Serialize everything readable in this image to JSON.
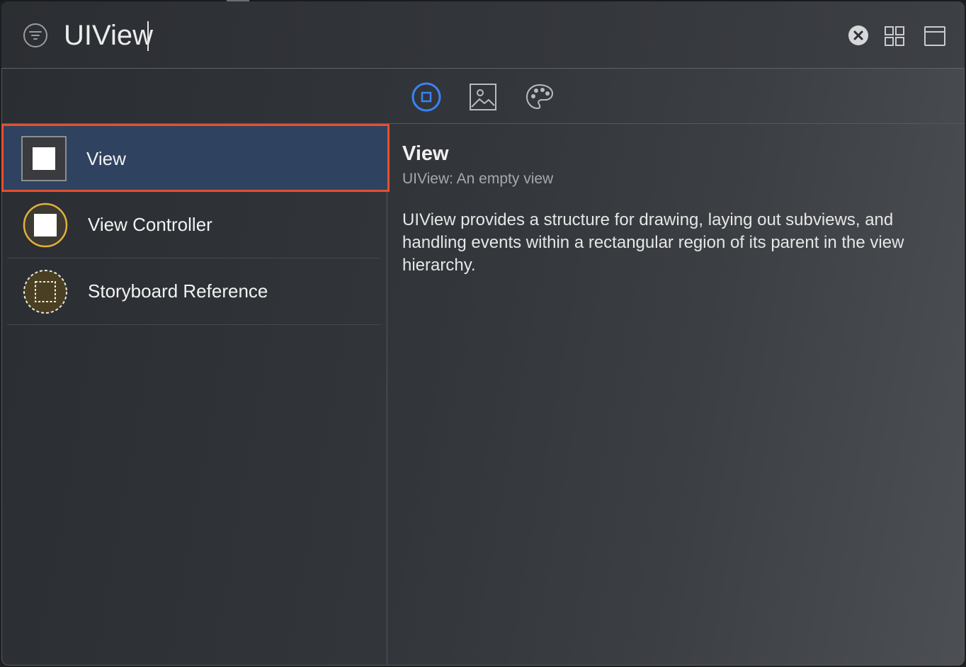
{
  "search": {
    "value": "UIView",
    "filter_icon": "filter-circle-icon",
    "clear_icon": "clear-circle-icon",
    "grid_icon": "grid-view-icon",
    "panel_icon": "detail-panel-icon"
  },
  "library_tabs": [
    {
      "name": "objects",
      "icon": "square-in-circle-icon",
      "selected": true
    },
    {
      "name": "media",
      "icon": "image-icon",
      "selected": false
    },
    {
      "name": "colors",
      "icon": "palette-icon",
      "selected": false
    }
  ],
  "list": {
    "items": [
      {
        "label": "View",
        "icon": "view-square-icon",
        "selected": true
      },
      {
        "label": "View Controller",
        "icon": "view-controller-icon",
        "selected": false
      },
      {
        "label": "Storyboard Reference",
        "icon": "storyboard-reference-icon",
        "selected": false
      }
    ]
  },
  "detail": {
    "title": "View",
    "subtitle": "UIView: An empty view",
    "description": "UIView provides a structure for drawing, laying out subviews, and handling events within a rectangular region of its parent in the view hierarchy."
  },
  "colors": {
    "accent_blue": "#3b82f6",
    "selection_bg": "#2f4260",
    "highlight_border": "#e4502f",
    "controller_yellow": "#e2b13c"
  }
}
